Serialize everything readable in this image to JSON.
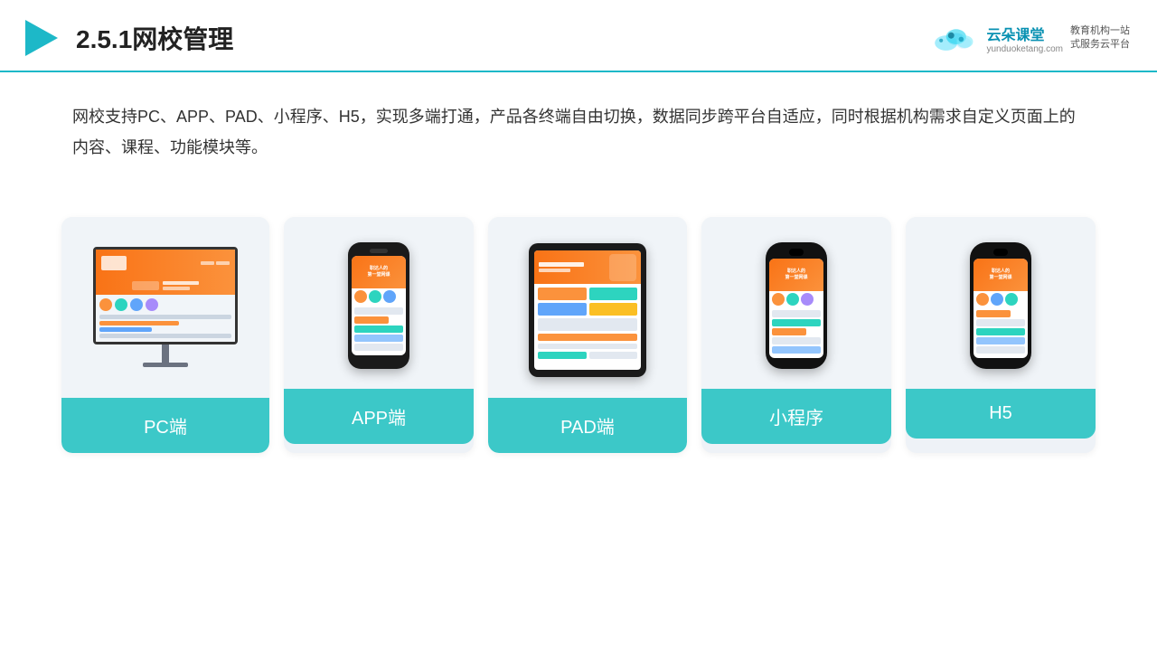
{
  "header": {
    "title": "2.5.1网校管理",
    "logo_name": "云朵课堂",
    "logo_domain": "yunduoketang.com",
    "logo_slogan": "教育机构一站\n式服务云平台"
  },
  "description": "网校支持PC、APP、PAD、小程序、H5，实现多端打通，产品各终端自由切换，数据同步跨平台自适应，同时根据机构需求自定义页面上的内容、课程、功能模块等。",
  "cards": [
    {
      "id": "pc",
      "label": "PC端"
    },
    {
      "id": "app",
      "label": "APP端"
    },
    {
      "id": "pad",
      "label": "PAD端"
    },
    {
      "id": "miniprogram",
      "label": "小程序"
    },
    {
      "id": "h5",
      "label": "H5"
    }
  ],
  "colors": {
    "accent": "#3cc8c8",
    "header_border": "#1db8c8",
    "card_bg": "#eef2f7",
    "label_bg": "#3cc8c8"
  }
}
